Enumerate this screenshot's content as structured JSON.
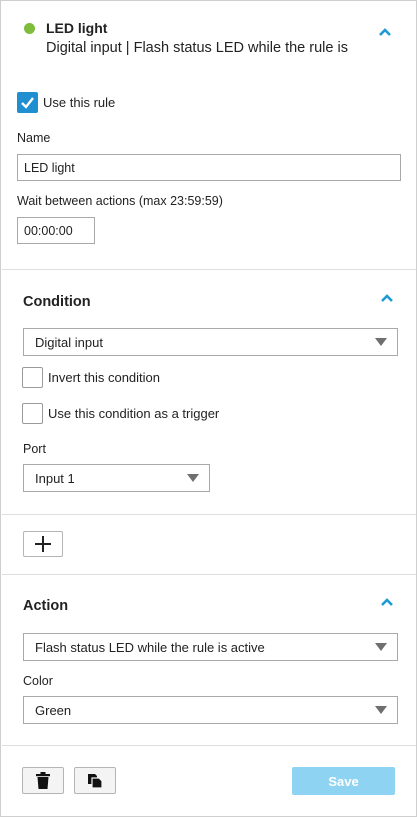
{
  "header": {
    "rule_name": "LED light",
    "rule_summary": "Digital input | Flash status LED while the rule is",
    "status_color": "#7dbd3b",
    "collapse_icon": "chevron-up-icon"
  },
  "general": {
    "use_rule_label": "Use this rule",
    "use_rule_checked": true,
    "name_label": "Name",
    "name_value": "LED light",
    "wait_label": "Wait between actions (max 23:59:59)",
    "wait_value": "00:00:00"
  },
  "condition": {
    "title": "Condition",
    "type_selected": "Digital input",
    "invert_label": "Invert this condition",
    "invert_checked": false,
    "trigger_label": "Use this condition as a trigger",
    "trigger_checked": false,
    "port_label": "Port",
    "port_selected": "Input 1"
  },
  "add_condition": {
    "icon": "plus-icon"
  },
  "action": {
    "title": "Action",
    "type_selected": "Flash status LED while the rule is active",
    "color_label": "Color",
    "color_selected": "Green"
  },
  "footer": {
    "delete_icon": "trash-icon",
    "copy_icon": "copy-icon",
    "save_label": "Save"
  },
  "colors": {
    "accent": "#1f8fd1",
    "save_disabled": "#8fd3f3",
    "status_on": "#7dbd3b"
  }
}
